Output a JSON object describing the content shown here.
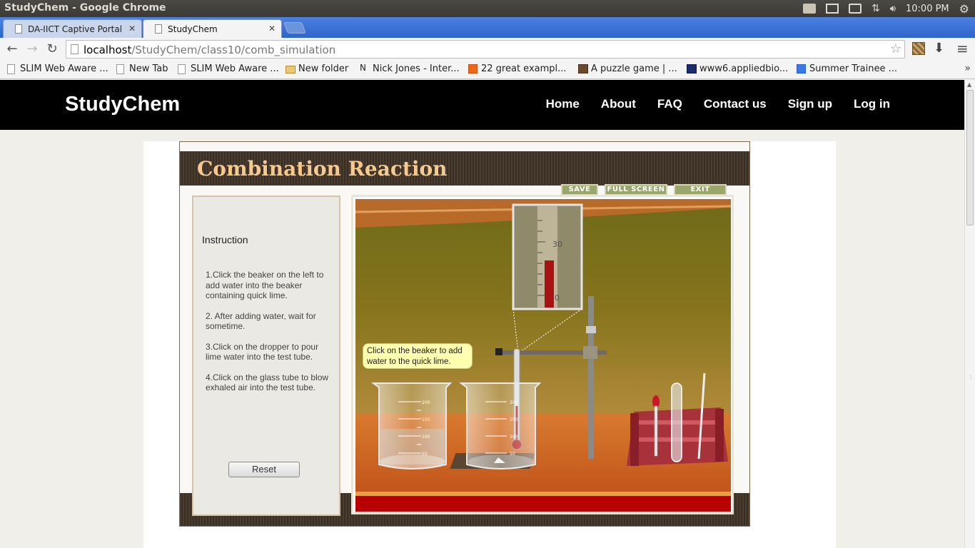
{
  "os": {
    "window_title": "StudyChem - Google Chrome",
    "clock": "10:00 PM"
  },
  "tabs": [
    {
      "label": "DA-IICT Captive Portal",
      "active": false
    },
    {
      "label": "StudyChem",
      "active": true
    }
  ],
  "address_bar": {
    "host": "localhost",
    "path": "/StudyChem/class10/comb_simulation"
  },
  "bookmarks": [
    {
      "label": "SLIM Web Aware ...",
      "icon": "page-icon"
    },
    {
      "label": "New Tab",
      "icon": "page-icon"
    },
    {
      "label": "SLIM Web Aware ...",
      "icon": "page-icon"
    },
    {
      "label": "New folder",
      "icon": "folder-icon"
    },
    {
      "label": "Nick Jones - Inter...",
      "icon": "site-icon"
    },
    {
      "label": "22 great exampl...",
      "icon": "site-icon"
    },
    {
      "label": "A puzzle game | ...",
      "icon": "site-icon"
    },
    {
      "label": "www6.appliedbio...",
      "icon": "site-icon"
    },
    {
      "label": "Summer Trainee ...",
      "icon": "google-icon"
    }
  ],
  "site": {
    "brand": "StudyChem",
    "nav": [
      "Home",
      "About",
      "FAQ",
      "Contact us",
      "Sign up",
      "Log in"
    ]
  },
  "simulation": {
    "title": "Combination Reaction",
    "buttons": {
      "save": "SAVE",
      "fullscreen": "FULL SCREEN",
      "exit": "EXIT"
    },
    "instruction_heading": "Instruction",
    "instructions": [
      "1.Click the beaker on the left to add water into the beaker containing quick lime.",
      "2. After adding water, wait for sometime.",
      "3.Click on the dropper to pour lime water into the test tube.",
      "4.Click on the glass tube to blow exhaled air into the test tube."
    ],
    "reset_label": "Reset",
    "tooltip": "Click on the beaker to add water to the quick lime.",
    "thermometer_scale": {
      "top_label": "30",
      "bottom_label": "0"
    },
    "beaker_marks": [
      "200",
      "150",
      "100",
      "50"
    ]
  }
}
